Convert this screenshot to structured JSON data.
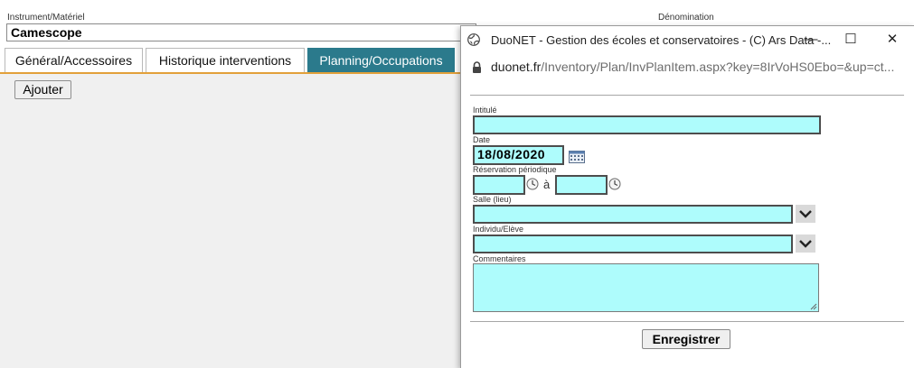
{
  "page": {
    "instrument_label": "Instrument/Matériel",
    "instrument_value": "Camescope",
    "denomination_label": "Dénomination",
    "tabs": [
      {
        "label": "Général/Accessoires"
      },
      {
        "label": "Historique interventions"
      },
      {
        "label": "Planning/Occupations",
        "active": true
      }
    ],
    "add_button": "Ajouter"
  },
  "popup": {
    "title": "DuoNET - Gestion des écoles et conservatoires - (C) Ars Data -...",
    "url_host": "duonet.fr",
    "url_path": "/Inventory/Plan/InvPlanItem.aspx?key=8IrVoHS0Ebo=&up=ct...",
    "controls": {
      "minimize": "—",
      "maximize": "☐",
      "close": "✕"
    },
    "form": {
      "intitule_label": "Intitulé",
      "date_label": "Date",
      "date_value": "18/08/2020",
      "reservation_label": "Réservation périodique",
      "to_label": "à",
      "salle_label": "Salle (lieu)",
      "individu_label": "Individu/Elève",
      "commentaires_label": "Commentaires",
      "save_button": "Enregistrer"
    }
  },
  "colors": {
    "active_tab": "#2b7a8c",
    "tab_underline": "#e2a03a",
    "field_fill": "#aefcfc"
  }
}
